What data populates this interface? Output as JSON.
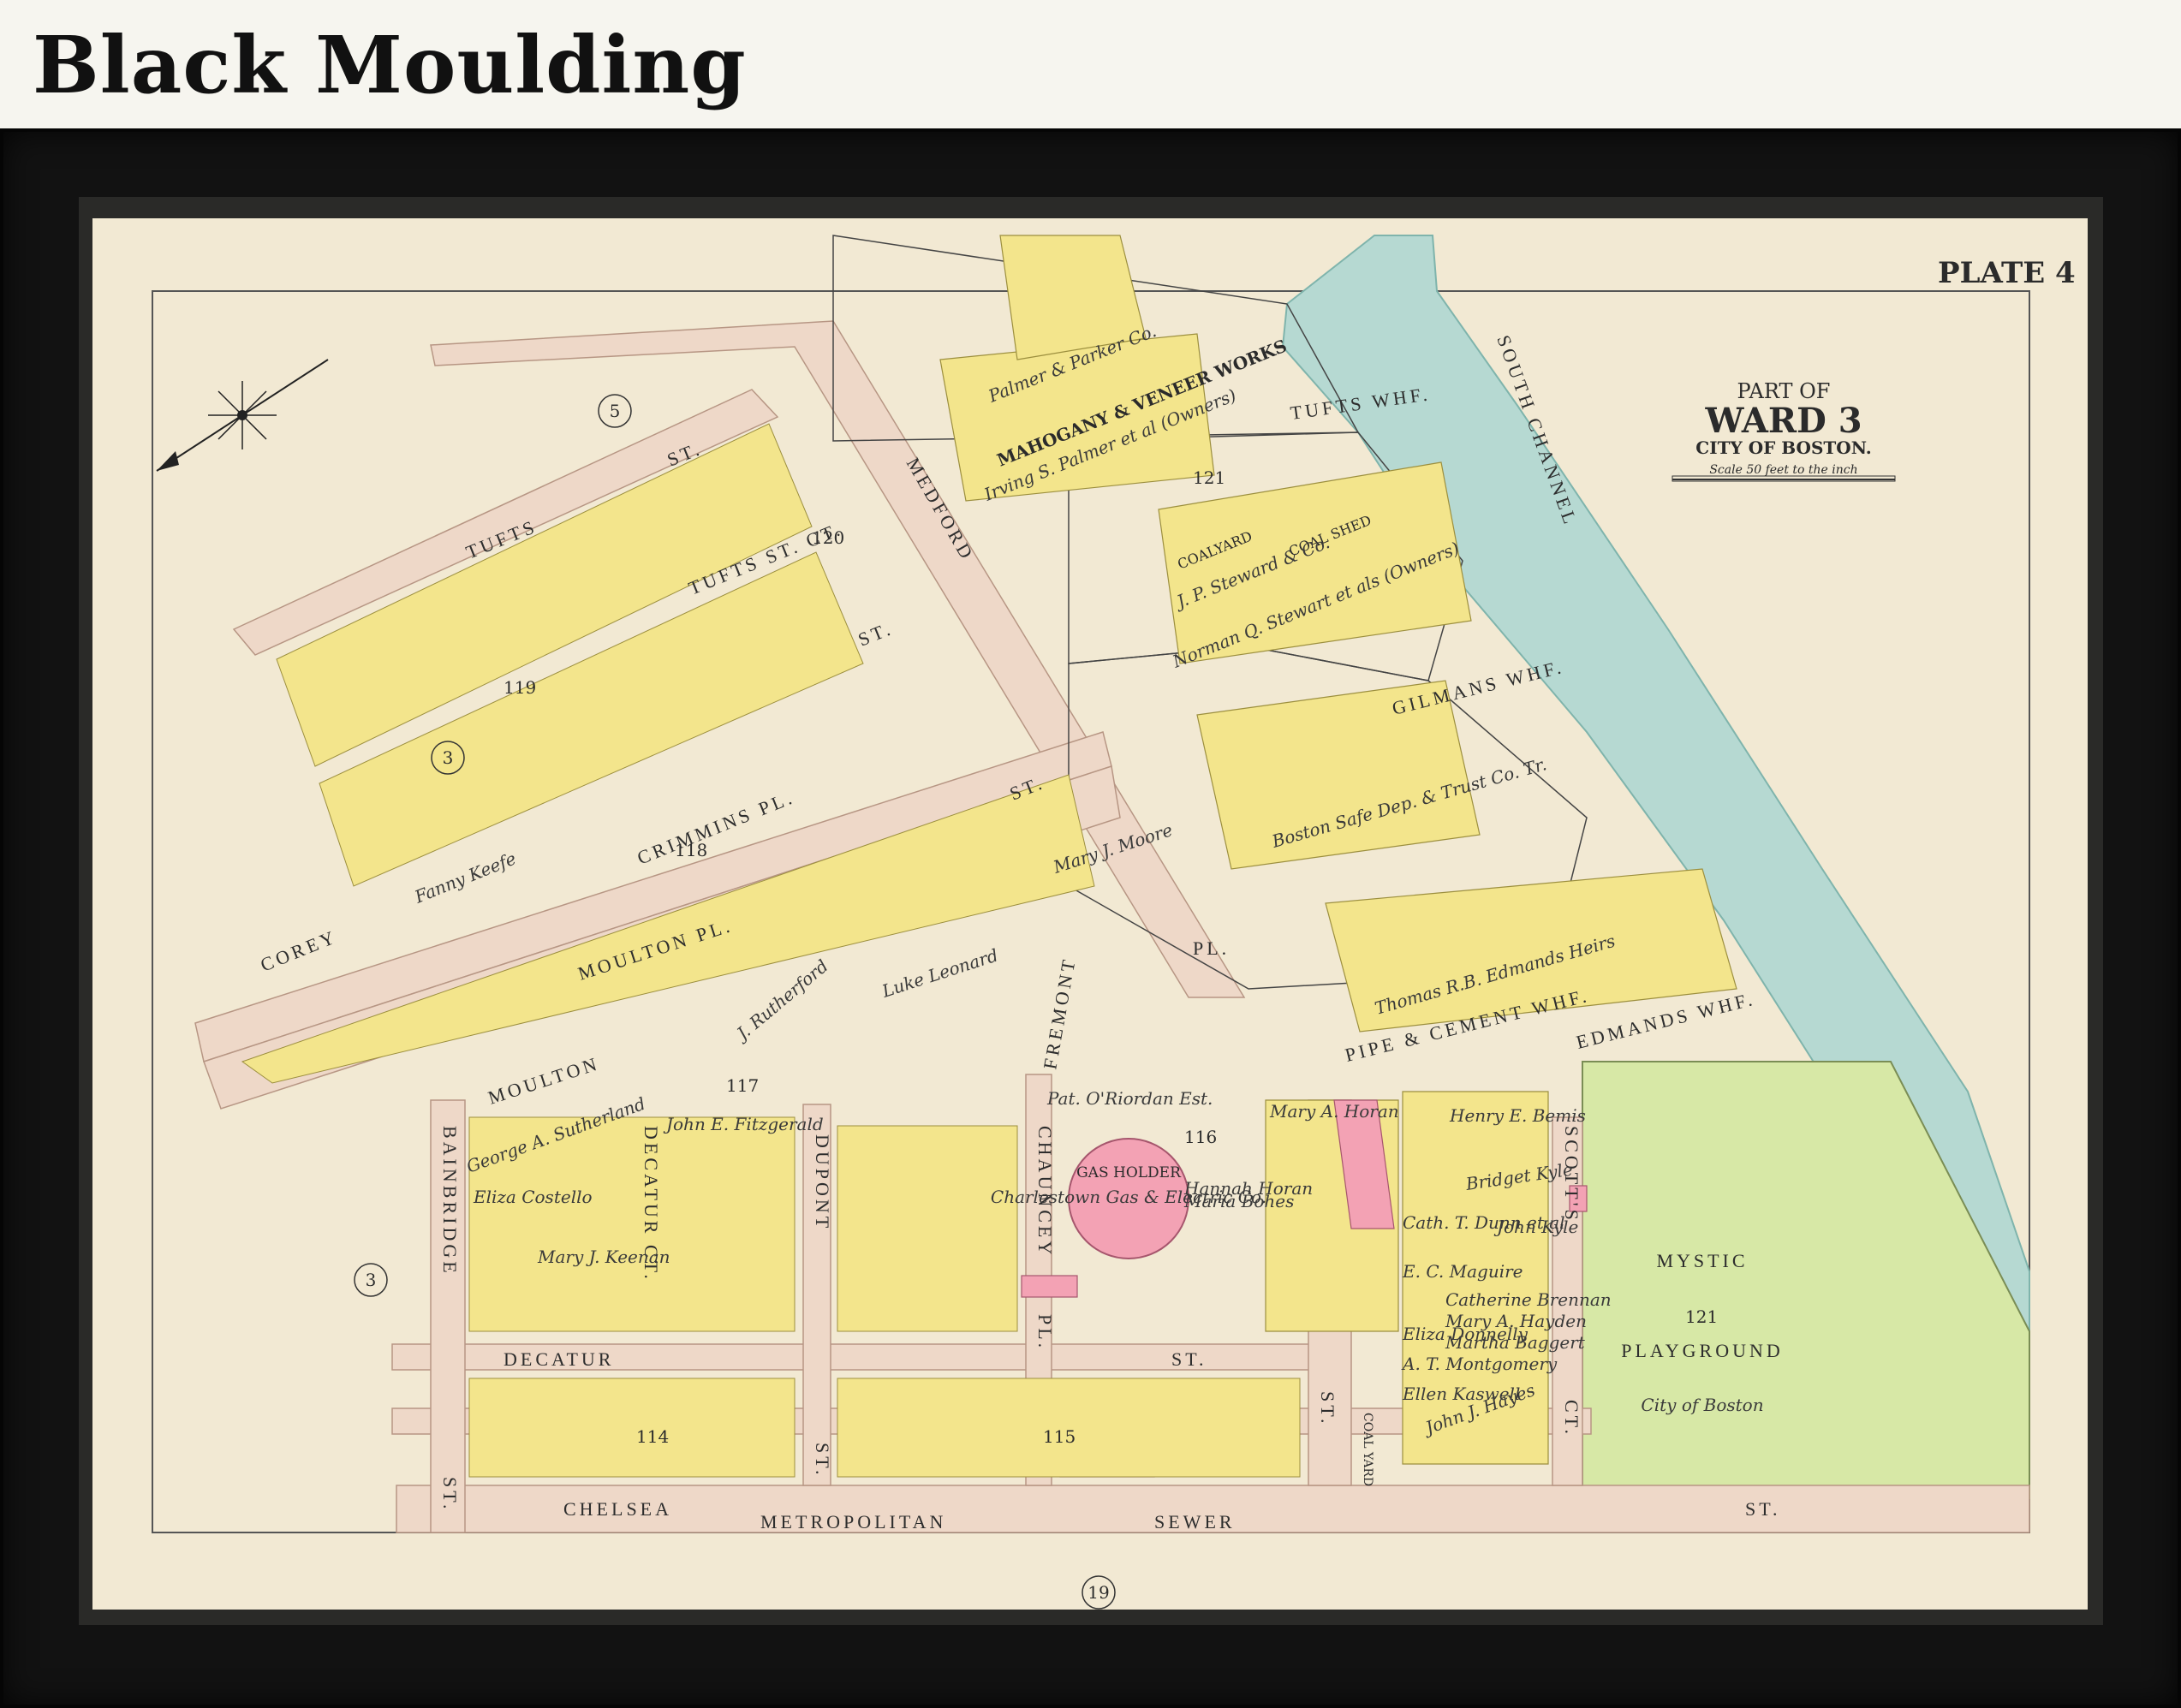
{
  "header": {
    "title": "Black Moulding"
  },
  "map": {
    "plate": "PLATE 4",
    "title_part": "PART OF",
    "title_ward": "WARD 3",
    "title_city": "CITY OF BOSTON.",
    "scale_text": "Scale 50 feet to the inch",
    "colors": {
      "paper": "#f2e9d3",
      "lot_yellow": "#f3e58c",
      "lot_pink": "#f3a2b4",
      "water": "#b6d9d2",
      "park": "#d7e8a6",
      "street": "#eed8c8",
      "ink": "#2b2b2b"
    },
    "streets": {
      "tufts": "TUFTS",
      "tufts_st": "ST.",
      "tufts_st_ct": "TUFTS ST. CT.",
      "medford": "MEDFORD",
      "medford_st": "ST.",
      "corey": "COREY",
      "corey_st": "ST.",
      "moulton": "MOULTON",
      "moulton_pl": "MOULTON PL.",
      "crimmins": "CRIMMINS PL.",
      "chelsea": "CHELSEA",
      "chelsea_st": "ST.",
      "decatur": "DECATUR",
      "decatur_st": "ST.",
      "decatur_ct": "DECATUR CT.",
      "bainbridge": "BAINBRIDGE",
      "bainbridge_st": "ST.",
      "dupont": "DUPONT",
      "dupont_st": "ST.",
      "chauncey": "CHAUNCEY",
      "chauncey_pl": "PL.",
      "fremont": "FREMONT",
      "fremont_pl": "PL.",
      "scotts": "SCOTT'S",
      "scotts_ct": "CT.",
      "park_st": "ST.",
      "metropolitan": "METROPOLITAN",
      "sewer": "SEWER",
      "south_channel": "SOUTH CHANNEL"
    },
    "wharves": {
      "tufts": "TUFTS WHF.",
      "gilmans": "GILMANS WHF.",
      "edmands": "EDMANDS WHF.",
      "pipe_cement": "PIPE & CEMENT WHF."
    },
    "landmarks": {
      "mahogany": "MAHOGANY & VENEER WORKS",
      "palmer_parker": "Palmer & Parker Co.",
      "irving": "Irving S. Palmer et al (Owners)",
      "coalyard": "COALYARD",
      "coal_shed": "COAL SHED",
      "jp_steward": "J. P. Steward & Co.",
      "norman": "Norman Q. Stewart et als (Owners)",
      "boston_safe": "Boston Safe Dep. & Trust Co. Tr.",
      "thomas": "Thomas R.B. Edmands Heirs",
      "gas_holder": "GAS HOLDER",
      "gas_co": "Charlestown Gas & Electric Co.",
      "mystic": "MYSTIC",
      "playground": "PLAYGROUND",
      "city_of_boston": "City of Boston",
      "coal_yard2": "COAL YARD"
    },
    "block_numbers": [
      "121",
      "120",
      "119",
      "118",
      "117",
      "116",
      "115",
      "114",
      "121"
    ],
    "circled": [
      "5",
      "3",
      "3",
      "19"
    ],
    "owners": [
      "Mary A. Horan",
      "John Kyle",
      "Bridget Kyle",
      "Henry E. Bemis",
      "E. C. Maguire",
      "Ellen Kaswell",
      "A. T. Montgomery",
      "Eliza Donnelly",
      "John J. Hayes",
      "Hannah Horan",
      "Maria Bohes",
      "Pat. O'Riordan Est.",
      "Mary A. Hayden",
      "Martha Baggert",
      "Catherine Brennan",
      "George A. Sutherland",
      "Eliza Costello",
      "Luke Leonard",
      "Mary J. Moore",
      "Fanny Keefe",
      "J. Rutherford",
      "John E. Fitzgerald",
      "Mary J. Keenan",
      "Cath. T. Dunn et al"
    ]
  }
}
